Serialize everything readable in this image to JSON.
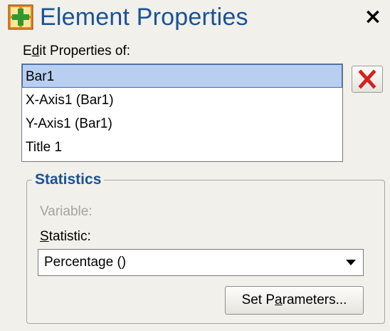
{
  "window": {
    "title": "Element Properties",
    "close_glyph": "×",
    "app_icon": "element-properties-icon"
  },
  "edit_properties": {
    "label_before": "E",
    "label_mnemonic": "d",
    "label_after": "it Properties of:",
    "items": [
      {
        "label": "Bar1",
        "selected": true
      },
      {
        "label": "X-Axis1 (Bar1)",
        "selected": false
      },
      {
        "label": "Y-Axis1 (Bar1)",
        "selected": false
      },
      {
        "label": "Title 1",
        "selected": false
      }
    ],
    "delete_icon": "red-x-delete-icon"
  },
  "statistics": {
    "legend": "Statistics",
    "variable_label": "Variable:",
    "statistic_label_mnemonic": "S",
    "statistic_label_after": "tatistic:",
    "selected_value": "Percentage ()",
    "set_parameters_before": "Set P",
    "set_parameters_mnemonic": "a",
    "set_parameters_after": "rameters..."
  },
  "colors": {
    "title": "#1a5296",
    "selection": "#b9cff1",
    "delete": "#d42020"
  }
}
